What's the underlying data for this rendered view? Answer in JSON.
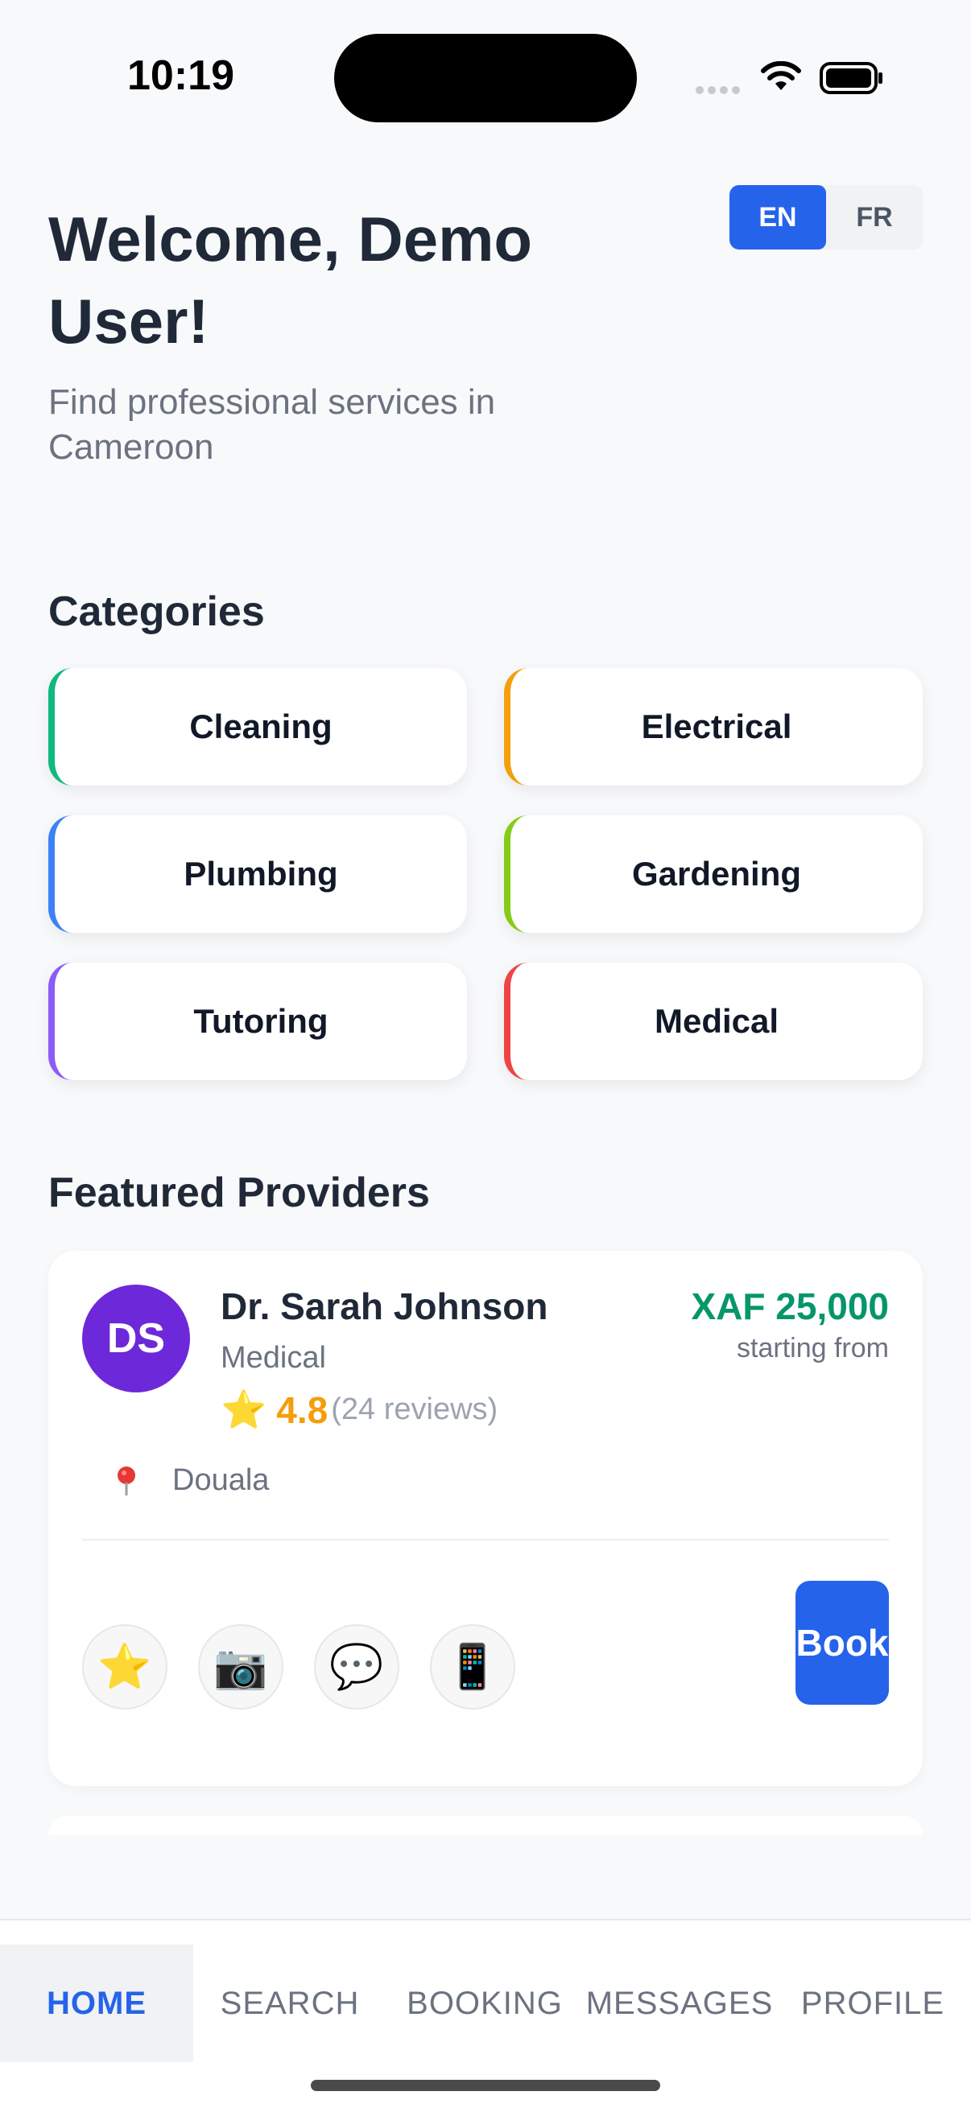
{
  "status_bar": {
    "time": "10:19"
  },
  "header": {
    "welcome": "Welcome, Demo User!",
    "subtitle": "Find professional services in Cameroon",
    "languages": [
      {
        "code": "EN",
        "active": true
      },
      {
        "code": "FR",
        "active": false
      }
    ]
  },
  "categories": {
    "title": "Categories",
    "items": [
      {
        "label": "Cleaning",
        "accent": "#10b981"
      },
      {
        "label": "Electrical",
        "accent": "#f59e0b"
      },
      {
        "label": "Plumbing",
        "accent": "#3b82f6"
      },
      {
        "label": "Gardening",
        "accent": "#84cc16"
      },
      {
        "label": "Tutoring",
        "accent": "#8b5cf6"
      },
      {
        "label": "Medical",
        "accent": "#ef4444"
      }
    ]
  },
  "featured": {
    "title": "Featured Providers",
    "provider": {
      "initials": "DS",
      "name": "Dr. Sarah Johnson",
      "category": "Medical",
      "rating": "4.8",
      "reviews": "(24 reviews)",
      "price": "XAF 25,000",
      "price_note": "starting from",
      "location": "Douala",
      "book_label": "Book",
      "actions": [
        {
          "icon": "star-icon",
          "glyph": "⭐"
        },
        {
          "icon": "camera-icon",
          "glyph": "📷"
        },
        {
          "icon": "chat-bubble-icon",
          "glyph": "💬"
        },
        {
          "icon": "phone-icon",
          "glyph": "📱"
        }
      ]
    }
  },
  "tab_bar": {
    "tabs": [
      {
        "label": "HOME",
        "active": true
      },
      {
        "label": "SEARCH",
        "active": false
      },
      {
        "label": "BOOKING",
        "active": false
      },
      {
        "label": "MESSAGES",
        "active": false
      },
      {
        "label": "PROFILE",
        "active": false
      }
    ]
  },
  "colors": {
    "primary": "#2563eb",
    "price": "#059669",
    "rating": "#f59e0b",
    "avatar": "#6d28d9"
  }
}
